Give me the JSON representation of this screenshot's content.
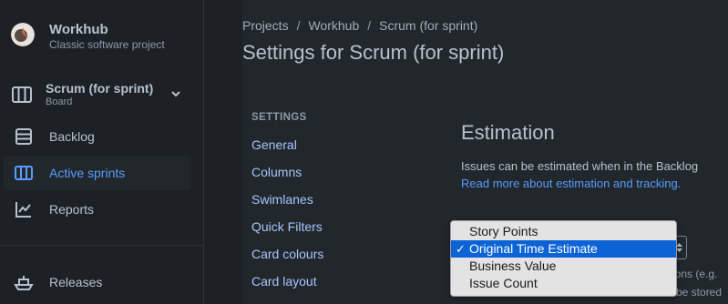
{
  "sidebar": {
    "project": {
      "name": "Workhub",
      "subtitle": "Classic software project"
    },
    "board": {
      "name": "Scrum (for sprint)",
      "subtitle": "Board"
    },
    "items": [
      {
        "label": "Backlog",
        "icon": "backlog-icon"
      },
      {
        "label": "Active sprints",
        "icon": "columns-board-icon",
        "active": true
      },
      {
        "label": "Reports",
        "icon": "chart-line-icon"
      },
      {
        "label": "Releases",
        "icon": "ship-icon"
      }
    ]
  },
  "breadcrumb": {
    "items": [
      "Projects",
      "Workhub",
      "Scrum (for sprint)"
    ],
    "separator": "/"
  },
  "page_title": "Settings for Scrum (for sprint)",
  "settings_nav": {
    "heading": "SETTINGS",
    "items": [
      "General",
      "Columns",
      "Swimlanes",
      "Quick Filters",
      "Card colours",
      "Card layout"
    ]
  },
  "estimation": {
    "title": "Estimation",
    "description": "Issues can be estimated when in the Backlog",
    "link": "Read more about estimation and tracking.",
    "partial_text_1": "ions (e.g.",
    "partial_text_2": "be stored"
  },
  "dropdown": {
    "options": [
      "Story Points",
      "Original Time Estimate",
      "Business Value",
      "Issue Count"
    ],
    "selected": "Original Time Estimate",
    "check_mark": "✓"
  },
  "colors": {
    "background": "#1d2125",
    "surface": "#22272b",
    "accent": "#579dff",
    "selection": "#0b63d6"
  }
}
